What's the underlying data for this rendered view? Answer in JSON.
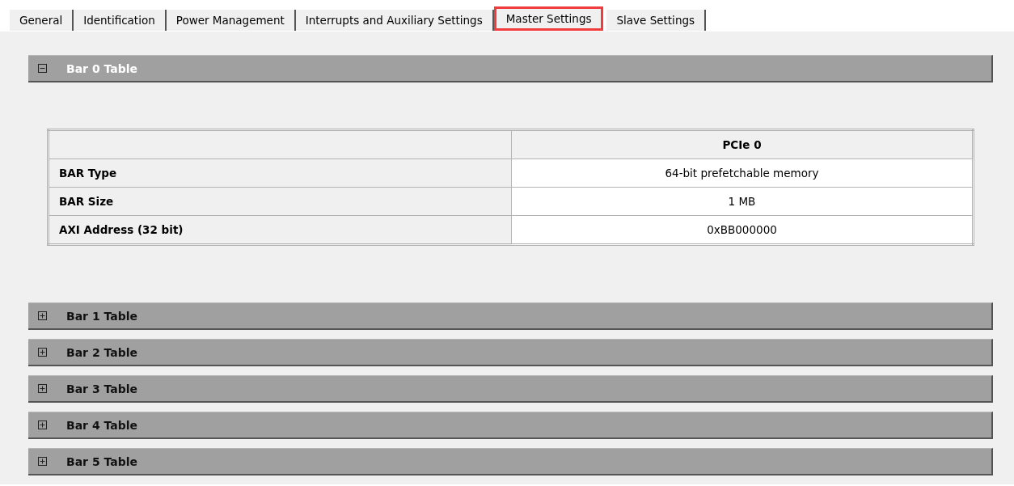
{
  "tabs": [
    {
      "label": "General",
      "selected": false
    },
    {
      "label": "Identification",
      "selected": false
    },
    {
      "label": "Power Management",
      "selected": false
    },
    {
      "label": "Interrupts and Auxiliary Settings",
      "selected": false
    },
    {
      "label": "Master Settings",
      "selected": true
    },
    {
      "label": "Slave Settings",
      "selected": false
    }
  ],
  "sections": [
    {
      "title": "Bar 0 Table",
      "expanded": true,
      "table": {
        "column_header": "PCIe 0",
        "rows": [
          {
            "label": "BAR Type",
            "value": "64-bit prefetchable memory"
          },
          {
            "label": "BAR Size",
            "value": "1 MB"
          },
          {
            "label": "AXI Address (32 bit)",
            "value": "0xBB000000"
          }
        ]
      }
    },
    {
      "title": "Bar 1 Table",
      "expanded": false
    },
    {
      "title": "Bar 2 Table",
      "expanded": false
    },
    {
      "title": "Bar 3 Table",
      "expanded": false
    },
    {
      "title": "Bar 4 Table",
      "expanded": false
    },
    {
      "title": "Bar 5 Table",
      "expanded": false
    }
  ]
}
